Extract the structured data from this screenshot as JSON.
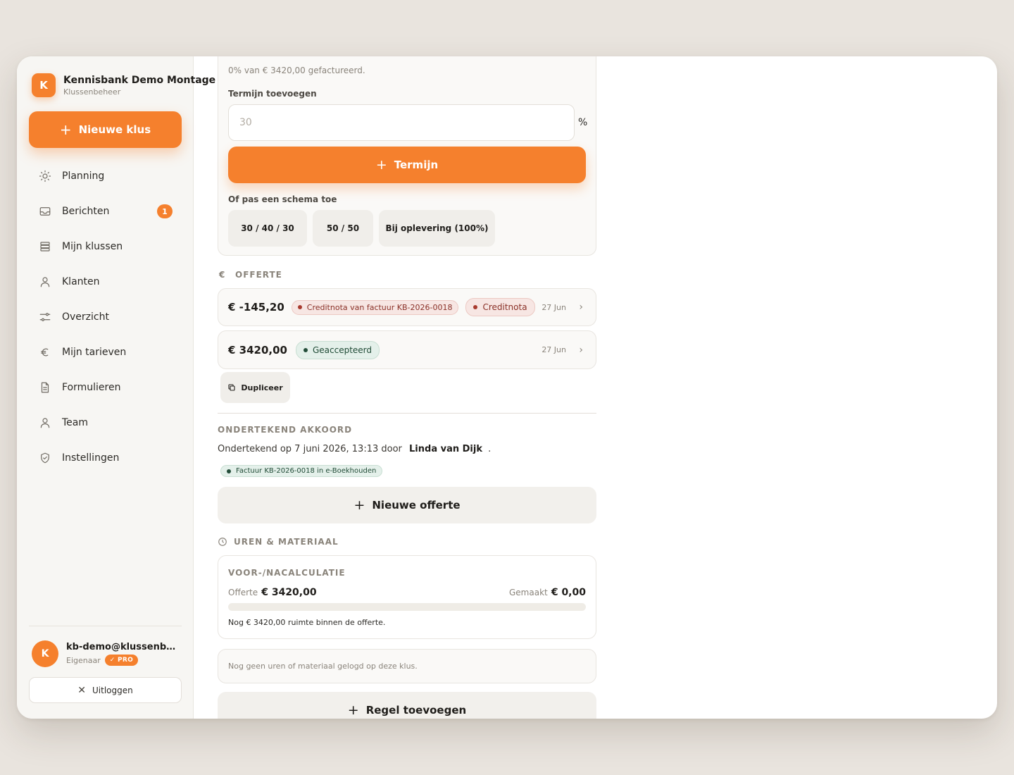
{
  "sidebar": {
    "brand_initial": "K",
    "brand_name": "Kennisbank Demo Montage",
    "brand_sub": "Klussenbeheer",
    "new_button": "Nieuwe klus",
    "items": [
      {
        "label": "Planning",
        "icon": "sun-icon"
      },
      {
        "label": "Berichten",
        "icon": "inbox-icon",
        "badge": "1"
      },
      {
        "label": "Mijn klussen",
        "icon": "stack-icon"
      },
      {
        "label": "Klanten",
        "icon": "person-icon"
      },
      {
        "label": "Overzicht",
        "icon": "sliders-icon"
      },
      {
        "label": "Mijn tarieven",
        "icon": "euro-icon"
      },
      {
        "label": "Formulieren",
        "icon": "document-icon"
      },
      {
        "label": "Team",
        "icon": "person-icon"
      },
      {
        "label": "Instellingen",
        "icon": "shield-icon"
      }
    ],
    "user": {
      "initial": "K",
      "email": "kb-demo@klussenbeheer.nl",
      "role": "Eigenaar",
      "plan": "✓ PRO"
    },
    "logout": "Uitloggen"
  },
  "termijnen": {
    "billed_text": "0% van € 3420,00 gefactureerd.",
    "add_label": "Termijn toevoegen",
    "input_placeholder": "30",
    "percent_sign": "%",
    "add_button": "Termijn",
    "schema_label": "Of pas een schema toe",
    "schemas": [
      "30 / 40 / 30",
      "50 / 50",
      "Bij oplevering (100%)"
    ]
  },
  "offerte": {
    "heading": "OFFERTE",
    "rows": [
      {
        "amount": "€ -145,20",
        "tag": "Creditnota van factuur KB-2026-0018",
        "status": "Creditnota",
        "date": "27 Jun"
      },
      {
        "amount": "€ 3420,00",
        "status": "Geaccepteerd",
        "date": "27 Jun"
      }
    ],
    "duplicate": "Dupliceer"
  },
  "akkoord": {
    "heading": "ONDERTEKEND AKKOORD",
    "text_prefix": "Ondertekend op 7 juni 2026, 13:13 door",
    "signer": "Linda van Dijk",
    "text_suffix": ".",
    "invoice_tag": "Factuur KB-2026-0018 in e-Boekhouden",
    "new_offer": "Nieuwe offerte"
  },
  "uren": {
    "heading": "UREN & MATERIAAL",
    "calc_title": "VOOR-/NACALCULATIE",
    "offer_label": "Offerte",
    "offer_value": "€ 3420,00",
    "made_label": "Gemaakt",
    "made_value": "€ 0,00",
    "progress_fraction": 0,
    "room_text": "Nog € 3420,00 ruimte binnen de offerte.",
    "empty_text": "Nog geen uren of materiaal gelogd op deze klus.",
    "add_line": "Regel toevoegen"
  },
  "colors": {
    "accent": "#f5802d",
    "red_status": "#a83a2e",
    "green_status": "#234d39"
  }
}
